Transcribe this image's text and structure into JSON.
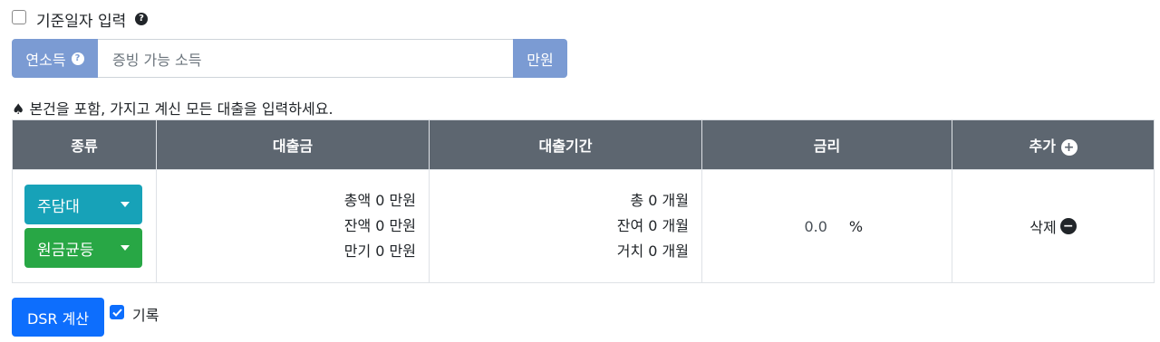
{
  "base_date": {
    "label": "기준일자 입력",
    "checked": false,
    "help_icon": "question-circle-icon"
  },
  "income": {
    "label": "연소득",
    "placeholder": "증빙 가능 소득",
    "unit": "만원",
    "help_icon": "question-circle-icon"
  },
  "notice": {
    "symbol": "♠",
    "text": "본건을 포함, 가지고 계신 모든 대출을 입력하세요."
  },
  "table": {
    "headers": {
      "type": "종류",
      "amount": "대출금",
      "period": "대출기간",
      "rate": "금리",
      "add": "추가"
    },
    "add_icon": "plus-circle-icon",
    "rows": [
      {
        "loan_type": "주담대",
        "repay_type": "원금균등",
        "amount": {
          "total_label": "총액",
          "total": "0",
          "balance_label": "잔액",
          "balance": "0",
          "maturity_label": "만기",
          "maturity": "0",
          "unit": "만원"
        },
        "period": {
          "total_label": "총",
          "total": "0",
          "remain_label": "잔여",
          "remain": "0",
          "grace_label": "거치",
          "grace": "0",
          "unit": "개월"
        },
        "rate": {
          "value": "0.0",
          "unit": "%"
        },
        "delete_label": "삭제",
        "delete_icon": "minus-circle-icon"
      }
    ]
  },
  "actions": {
    "calculate_label": "DSR 계산",
    "record_label": "기록",
    "record_checked": true
  },
  "colors": {
    "primary": "#0d6efd",
    "group_addon": "#7b9bd3",
    "header_bg": "#5d6670",
    "loan_type_btn": "#17a2b8",
    "repay_btn": "#28a745"
  }
}
